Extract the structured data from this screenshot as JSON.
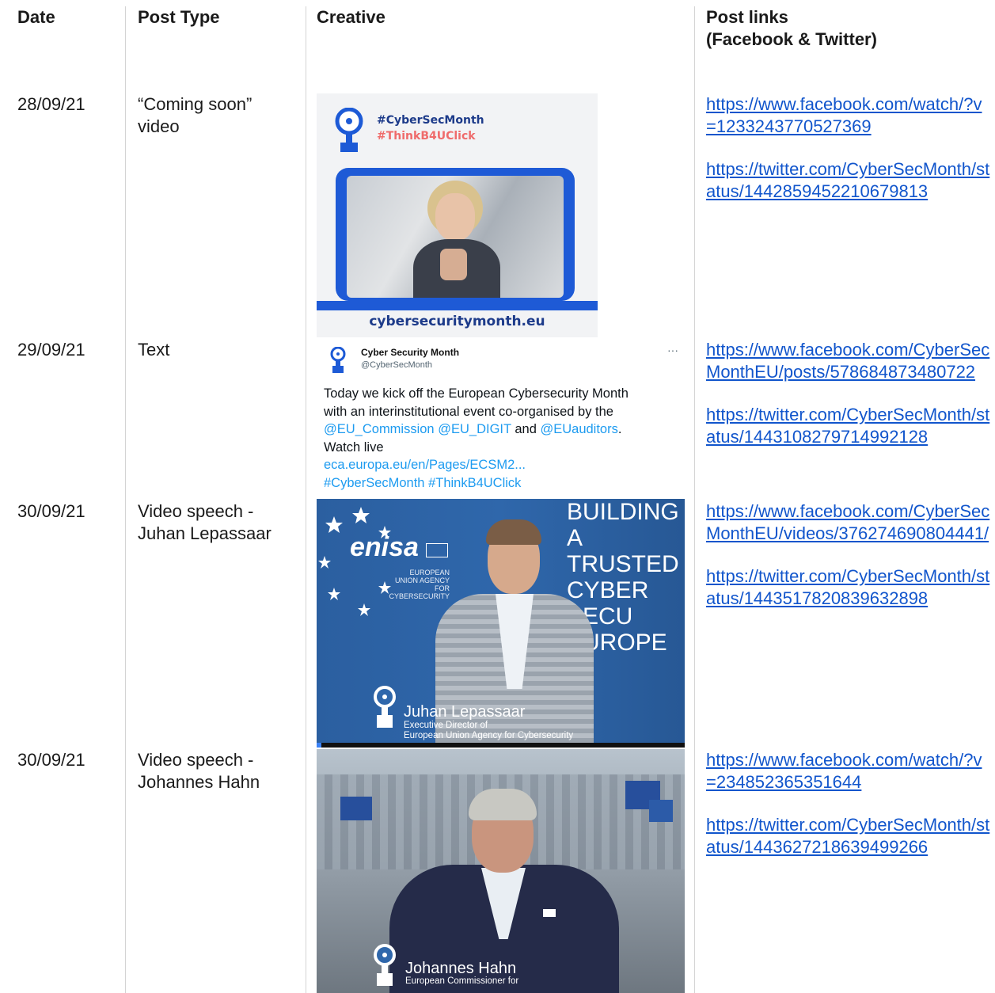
{
  "headers": {
    "date": "Date",
    "post_type": "Post Type",
    "creative": "Creative",
    "post_links_1": "Post links",
    "post_links_2": "(Facebook & Twitter)"
  },
  "rows": [
    {
      "date": "28/09/21",
      "type_1": "“Coming soon”",
      "type_2": "video",
      "creative": {
        "tag1": "#CyberSecMonth",
        "tag2": "#ThinkB4UClick",
        "url": "cybersecuritymonth.eu"
      },
      "links": [
        "https://www.facebook.com/watch/?v=1233243770527369",
        "https://twitter.com/CyberSecMonth/status/1442859452210679813"
      ]
    },
    {
      "date": "29/09/21",
      "type_1": "Text",
      "creative": {
        "name": "Cyber Security Month",
        "handle": "@CyberSecMonth",
        "more": "···",
        "line1": "Today we kick off the European Cybersecurity Month",
        "line2": "with an interinstitutional event co-organised by the",
        "mention1": "@EU_Commission",
        "mention2": "@EU_DIGIT",
        "and": "and",
        "mention3": "@EUauditors",
        "period": ".",
        "watch": "Watch live",
        "link": "eca.europa.eu/en/Pages/ECSM2...",
        "hashtags": "#CyberSecMonth #ThinkB4UClick"
      },
      "links": [
        "https://www.facebook.com/CyberSecMonthEU/posts/578684873480722",
        "https://twitter.com/CyberSecMonth/status/1443108279714992128"
      ]
    },
    {
      "date": "30/09/21",
      "type_1": "Video speech -",
      "type_2": "Juhan Lepassaar",
      "creative": {
        "brand": "enisa",
        "agency_1": "EUROPEAN",
        "agency_2": "UNION AGENCY",
        "agency_3": "FOR CYBERSECURITY",
        "building_1": "BUILDING",
        "building_2": "A TRUSTED",
        "building_3": "CYBER SECU",
        "building_4": "EUROPE",
        "caption_name": "Juhan Lepassaar",
        "caption_role_1": "Executive Director of",
        "caption_role_2": "European Union Agency for Cybersecurity"
      },
      "links": [
        "https://www.facebook.com/CyberSecMonthEU/videos/376274690804441/",
        "https://twitter.com/CyberSecMonth/status/1443517820839632898"
      ]
    },
    {
      "date": "30/09/21",
      "type_1": "Video speech -",
      "type_2": "Johannes Hahn",
      "creative": {
        "caption_name": "Johannes Hahn",
        "caption_role_1": "European Commissioner for"
      },
      "links": [
        "https://www.facebook.com/watch/?v=234852365351644",
        "https://twitter.com/CyberSecMonth/status/1443627218639499266"
      ]
    }
  ],
  "colors": {
    "link": "#1155cc",
    "brand_blue": "#1d3b8a",
    "accent_red": "#ef6b6b",
    "twitter_blue": "#1d9bf0"
  }
}
